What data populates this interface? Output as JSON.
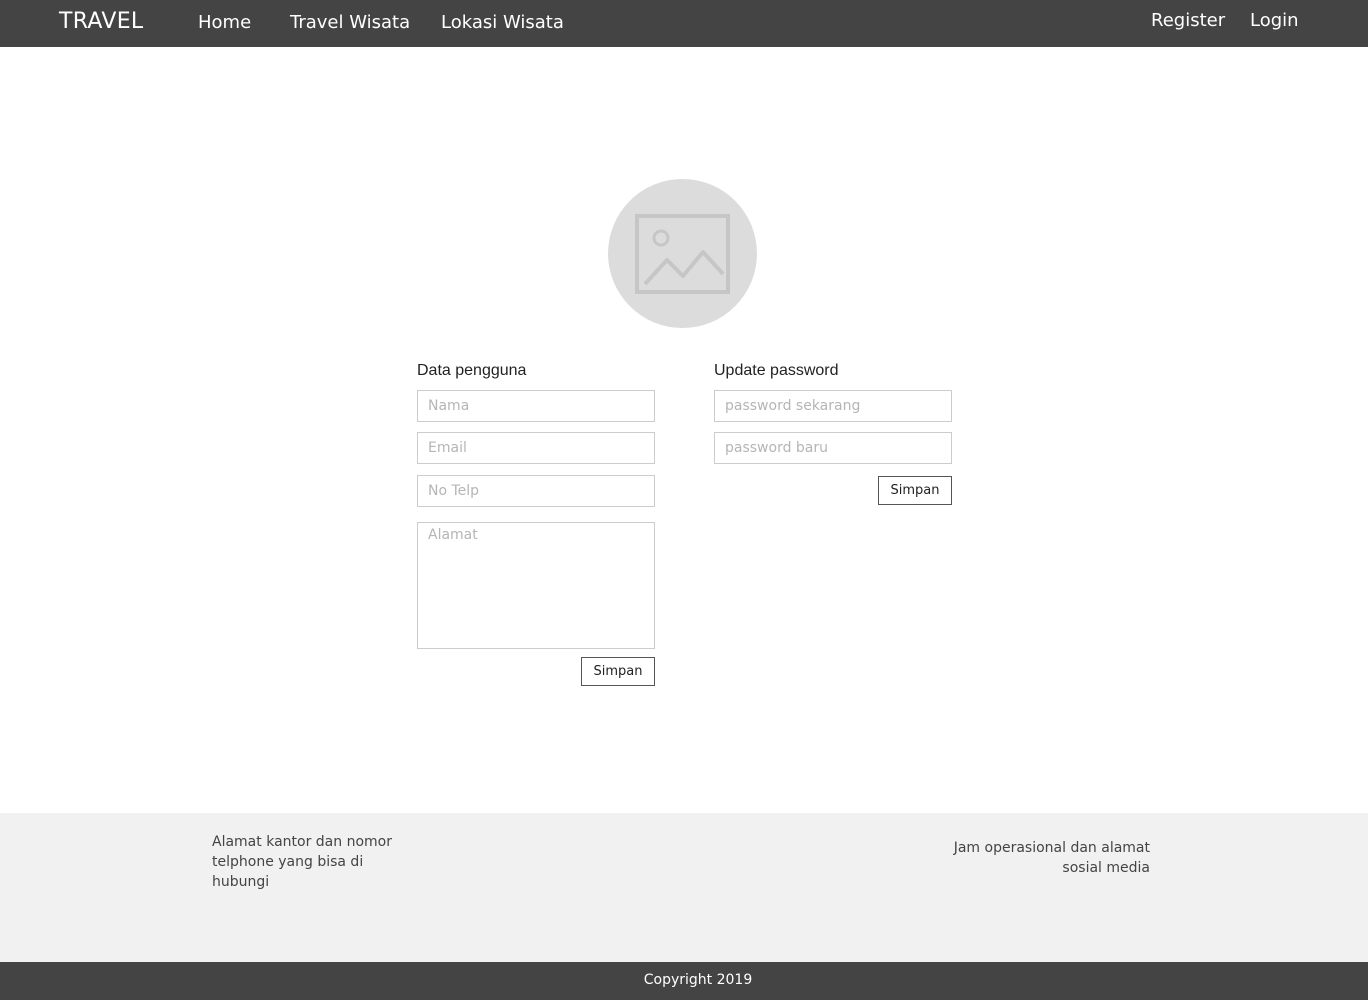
{
  "navbar": {
    "brand": "TRAVEL",
    "links": [
      "Home",
      "Travel Wisata",
      "Lokasi Wisata"
    ],
    "auth": {
      "register": "Register",
      "login": "Login"
    }
  },
  "avatar": {
    "icon": "image-placeholder-icon"
  },
  "data_pengguna": {
    "title": "Data pengguna",
    "nama_placeholder": "Nama",
    "email_placeholder": "Email",
    "telp_placeholder": "No Telp",
    "alamat_placeholder": "Alamat",
    "submit_label": "Simpan"
  },
  "update_password": {
    "title": "Update password",
    "current_placeholder": "password sekarang",
    "new_placeholder": "password baru",
    "submit_label": "Simpan"
  },
  "footer": {
    "left_text": "Alamat kantor dan nomor telphone yang bisa di hubungi",
    "right_text": "Jam operasional dan alamat sosial media",
    "copyright": "Copyright 2019"
  },
  "colors": {
    "navbar_bg": "#444444",
    "footer_info_bg": "#f1f1f1",
    "avatar_bg": "#dcdcdc"
  }
}
